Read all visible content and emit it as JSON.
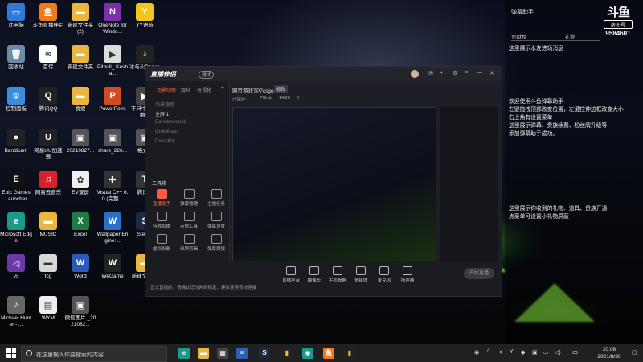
{
  "desktop_icons": [
    {
      "label": "此电脑",
      "icon": "computer-icon",
      "color": "#2f7bd4",
      "glyph": "▭"
    },
    {
      "label": "斗鱼直播伴侣",
      "icon": "douyu-icon",
      "color": "#f07a1a",
      "glyph": "鱼"
    },
    {
      "label": "新建文件夹 (2)",
      "icon": "folder-icon",
      "color": "#e9b740",
      "glyph": "▬"
    },
    {
      "label": "OneNote for Windo...",
      "icon": "onenote-icon",
      "color": "#7b2fa8",
      "glyph": "N"
    },
    {
      "label": "YY语音",
      "icon": "yy-icon",
      "color": "#f3c41a",
      "glyph": "Y"
    },
    {
      "label": "回收站",
      "icon": "recycle-bin-icon",
      "color": "#6b8aa8",
      "glyph": "🗑"
    },
    {
      "label": "百传",
      "icon": "baichuan-icon",
      "color": "#ffffff",
      "glyph": "∞"
    },
    {
      "label": "新建文件夹",
      "icon": "folder-icon",
      "color": "#e9b740",
      "glyph": "▬"
    },
    {
      "label": "Pitbull_ Kesha...",
      "icon": "video-file-icon",
      "color": "#ddd",
      "glyph": "▶"
    },
    {
      "label": "冰与火Dance",
      "icon": "music-file-icon",
      "color": "#222",
      "glyph": "♪"
    },
    {
      "label": "控制面板",
      "icon": "control-panel-icon",
      "color": "#3a8fd8",
      "glyph": "⚙"
    },
    {
      "label": "腾讯QQ",
      "icon": "qq-icon",
      "color": "#222",
      "glyph": "Q"
    },
    {
      "label": "食娱",
      "icon": "folder-icon",
      "color": "#e9b740",
      "glyph": "▬"
    },
    {
      "label": "PowerPoint",
      "icon": "powerpoint-icon",
      "color": "#d04a24",
      "glyph": "P"
    },
    {
      "label": "不只中者 一曲...",
      "icon": "video-file-icon",
      "color": "#444",
      "glyph": "▶"
    },
    {
      "label": "Bandicam",
      "icon": "bandicam-icon",
      "color": "#222",
      "glyph": "●"
    },
    {
      "label": "网易UU加速器",
      "icon": "uu-icon",
      "color": "#222",
      "glyph": "U"
    },
    {
      "label": "20210827...",
      "icon": "image-file-icon",
      "color": "#555",
      "glyph": "▣"
    },
    {
      "label": "share_226...",
      "icon": "image-file-icon",
      "color": "#555",
      "glyph": "▣"
    },
    {
      "label": "格式...",
      "icon": "file-icon",
      "color": "#555",
      "glyph": "▣"
    },
    {
      "label": "Epic Games Launcher",
      "icon": "epic-games-icon",
      "color": "#111",
      "glyph": "E"
    },
    {
      "label": "网易云音乐",
      "icon": "netease-music-icon",
      "color": "#d8212a",
      "glyph": "♫"
    },
    {
      "label": "EV录屏",
      "icon": "ev-recorder-icon",
      "color": "#eee",
      "glyph": "✿"
    },
    {
      "label": "Visual C++ 6.0 (完整...",
      "icon": "visual-cpp-icon",
      "color": "#333",
      "glyph": "✚"
    },
    {
      "label": "腾讯...",
      "icon": "tencent-icon",
      "color": "#333",
      "glyph": "T"
    },
    {
      "label": "Microsoft Edge",
      "icon": "edge-icon",
      "color": "#1a9a8a",
      "glyph": "e"
    },
    {
      "label": "MUSIC",
      "icon": "folder-icon",
      "color": "#e9b740",
      "glyph": "▬"
    },
    {
      "label": "Excel",
      "icon": "excel-icon",
      "color": "#1f7a44",
      "glyph": "X"
    },
    {
      "label": "Wallpaper Engine:...",
      "icon": "wallpaper-engine-icon",
      "color": "#2b6fc7",
      "glyph": "W"
    },
    {
      "label": "Steam",
      "icon": "steam-icon",
      "color": "#1b2a40",
      "glyph": "S"
    },
    {
      "label": "vs",
      "icon": "visual-studio-icon",
      "color": "#6a3aa8",
      "glyph": "◁"
    },
    {
      "label": "fcg",
      "icon": "folder-icon",
      "color": "#d8d8d8",
      "glyph": "▬"
    },
    {
      "label": "Word",
      "icon": "word-icon",
      "color": "#2b5bb8",
      "glyph": "W"
    },
    {
      "label": "WeGame",
      "icon": "wegame-icon",
      "color": "#222",
      "glyph": "W"
    },
    {
      "label": "新建文件夹",
      "icon": "folder-icon",
      "color": "#e9b740",
      "glyph": "▬"
    },
    {
      "label": "Michael Hunter - ...",
      "icon": "music-file-icon",
      "color": "#666",
      "glyph": "♪"
    },
    {
      "label": "WYM",
      "icon": "file-icon",
      "color": "#eee",
      "glyph": "▤"
    },
    {
      "label": "微信图片 _2021082...",
      "icon": "image-file-icon",
      "color": "#555",
      "glyph": "▣"
    }
  ],
  "right_panel": {
    "title": "弹幕助手",
    "tabs": [
      "贡献榜",
      "礼物"
    ],
    "logo_mark": "斗鱼",
    "logo_sub": "房间号",
    "room_number": "9584601",
    "top_message": "这里展示水友进场消息",
    "messages": [
      "欢迎使用斗鱼弹幕助手",
      "左键拖拽顶部改变位置，左键拉伸边框改变大小",
      "右上角有设置菜单",
      "这里展示弹幕、贵族续费、粉丝牌升级等",
      "添加弹幕助手成功。"
    ],
    "gift_messages": [
      "这里展示你收到的礼物、道具、贵族开通",
      "点菜单可设置小礼物屏蔽"
    ]
  },
  "app": {
    "brand": "直播伴侣",
    "badge": "测试",
    "side_tabs": [
      "场景切换",
      "观众",
      "可视化"
    ],
    "scene_rows": [
      "场景管理",
      "全屏 1",
      "Dancemode11",
      "Grolo8 abs",
      "Dresslink..."
    ],
    "tools_title": "工具箱",
    "tools": [
      {
        "label": "直播助手",
        "red": true
      },
      {
        "label": "弹幕管理",
        "red": false
      },
      {
        "label": "主播任务",
        "red": false
      },
      {
        "label": "特效直播",
        "red": false
      },
      {
        "label": "点歌工具",
        "red": false
      },
      {
        "label": "弹幕设置",
        "red": false
      },
      {
        "label": "虚拟形象",
        "red": false
      },
      {
        "label": "录屏剪辑",
        "red": false
      },
      {
        "label": "弹幕周报",
        "red": false
      }
    ],
    "preview_title": "网页游戏TP7csgo",
    "preview_btn": "修改",
    "preview_stats": [
      "已保存",
      "PGrab",
      "14/26",
      "0"
    ],
    "bottom_tools": [
      "直播声音",
      "摄像头",
      "手机投屏",
      "多媒体",
      "麦克风",
      "扬声器"
    ],
    "go_live": "开始直播",
    "notice": "正式直播前，请确认您的网络稳定，建议使用有线连接"
  },
  "taskbar": {
    "search_placeholder": "在这里输入你要搜索的内容",
    "time": "20:08",
    "date": "2021/8/30",
    "ime": "中"
  }
}
